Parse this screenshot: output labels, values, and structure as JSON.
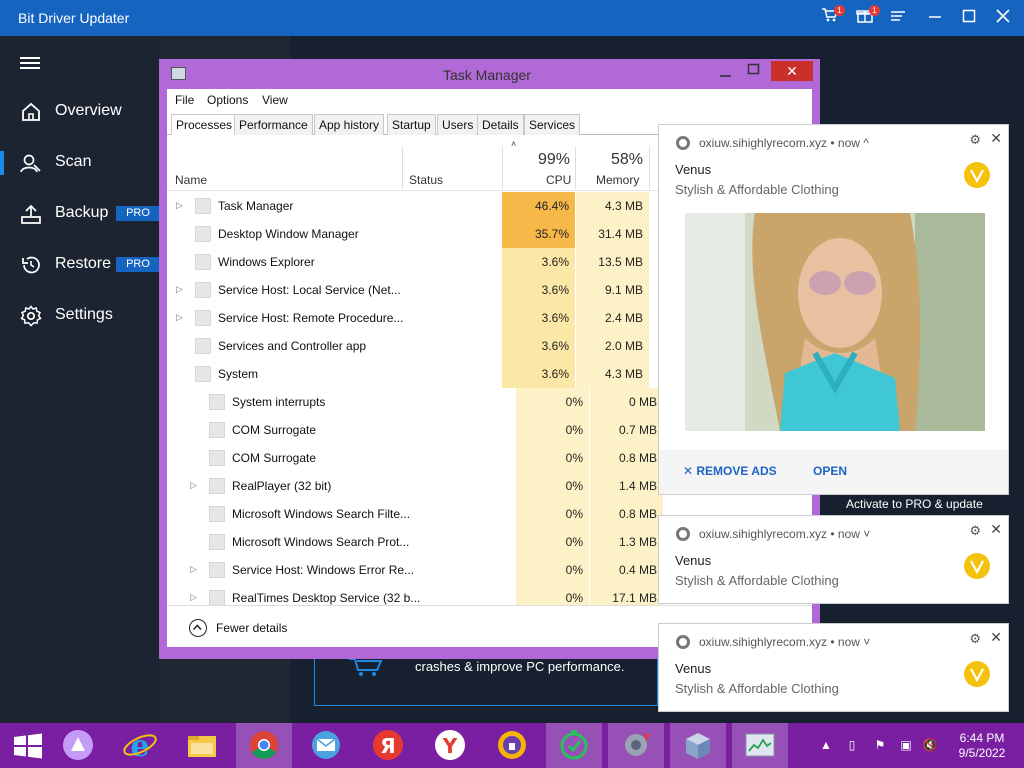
{
  "bdu": {
    "title": "Bit Driver Updater",
    "cart_badge": "1",
    "gift_badge": "1",
    "nav": [
      {
        "label": "Overview",
        "icon": "home-icon"
      },
      {
        "label": "Scan",
        "icon": "scan-user-icon"
      },
      {
        "label": "Backup",
        "icon": "backup-icon",
        "pro": "PRO"
      },
      {
        "label": "Restore",
        "icon": "restore-icon",
        "pro": "PRO"
      },
      {
        "label": "Settings",
        "icon": "gear-icon"
      }
    ],
    "banner_text": "crashes & improve PC performance.",
    "activate_text": "Activate to PRO & update",
    "accent": "#1565c0"
  },
  "task_manager": {
    "title": "Task Manager",
    "menu": [
      "File",
      "Options",
      "View"
    ],
    "tabs": [
      "Processes",
      "Performance",
      "App history",
      "Startup",
      "Users",
      "Details",
      "Services"
    ],
    "columns": {
      "name": "Name",
      "status": "Status",
      "cpu_pct": "99%",
      "cpu": "CPU",
      "mem_pct": "58%",
      "memory": "Memory"
    },
    "rows": [
      {
        "name": "Task Manager",
        "cpu": "46.4%",
        "mem": "4.3 MB",
        "expand": true
      },
      {
        "name": "Desktop Window Manager",
        "cpu": "35.7%",
        "mem": "31.4 MB",
        "expand": false
      },
      {
        "name": "Windows Explorer",
        "cpu": "3.6%",
        "mem": "13.5 MB",
        "expand": false
      },
      {
        "name": "Service Host: Local Service (Net...",
        "cpu": "3.6%",
        "mem": "9.1 MB",
        "expand": true
      },
      {
        "name": "Service Host: Remote Procedure...",
        "cpu": "3.6%",
        "mem": "2.4 MB",
        "expand": true
      },
      {
        "name": "Services and Controller app",
        "cpu": "3.6%",
        "mem": "2.0 MB",
        "expand": false
      },
      {
        "name": "System",
        "cpu": "3.6%",
        "mem": "4.3 MB",
        "expand": false
      },
      {
        "name": "System interrupts",
        "cpu": "0%",
        "mem": "0 MB",
        "expand": false
      },
      {
        "name": "COM Surrogate",
        "cpu": "0%",
        "mem": "0.7 MB",
        "expand": false
      },
      {
        "name": "COM Surrogate",
        "cpu": "0%",
        "mem": "0.8 MB",
        "expand": false
      },
      {
        "name": "RealPlayer (32 bit)",
        "cpu": "0%",
        "mem": "1.4 MB",
        "expand": true
      },
      {
        "name": "Microsoft Windows Search Filte...",
        "cpu": "0%",
        "mem": "0.8 MB",
        "expand": false
      },
      {
        "name": "Microsoft Windows Search Prot...",
        "cpu": "0%",
        "mem": "1.3 MB",
        "expand": false
      },
      {
        "name": "Service Host: Windows Error Re...",
        "cpu": "0%",
        "mem": "0.4 MB",
        "expand": true
      },
      {
        "name": "RealTimes Desktop Service (32 b...",
        "cpu": "0%",
        "mem": "17.1 MB",
        "expand": true
      }
    ],
    "fewer_details": "Fewer details"
  },
  "notifications": [
    {
      "source": "oxiuw.sihighlyrecom.xyz",
      "time": "• now ^",
      "title": "Venus",
      "subtitle": "Stylish & Affordable Clothing",
      "remove_ads": "REMOVE ADS",
      "open": "OPEN"
    },
    {
      "source": "oxiuw.sihighlyrecom.xyz",
      "time": "• now ˅",
      "title": "Venus",
      "subtitle": "Stylish & Affordable Clothing"
    },
    {
      "source": "oxiuw.sihighlyrecom.xyz",
      "time": "• now ˅",
      "title": "Venus",
      "subtitle": "Stylish & Affordable Clothing"
    }
  ],
  "taskbar": {
    "apps": [
      "windows-start-icon",
      "alice-icon",
      "internet-explorer-icon",
      "file-explorer-icon",
      "chrome-icon",
      "mail-icon",
      "yandex-icon",
      "yandex-browser-icon",
      "vpn-icon",
      "timer-icon",
      "settings-app-icon",
      "box-app-icon",
      "task-manager-icon"
    ],
    "time": "6:44 PM",
    "date": "9/5/2022"
  }
}
